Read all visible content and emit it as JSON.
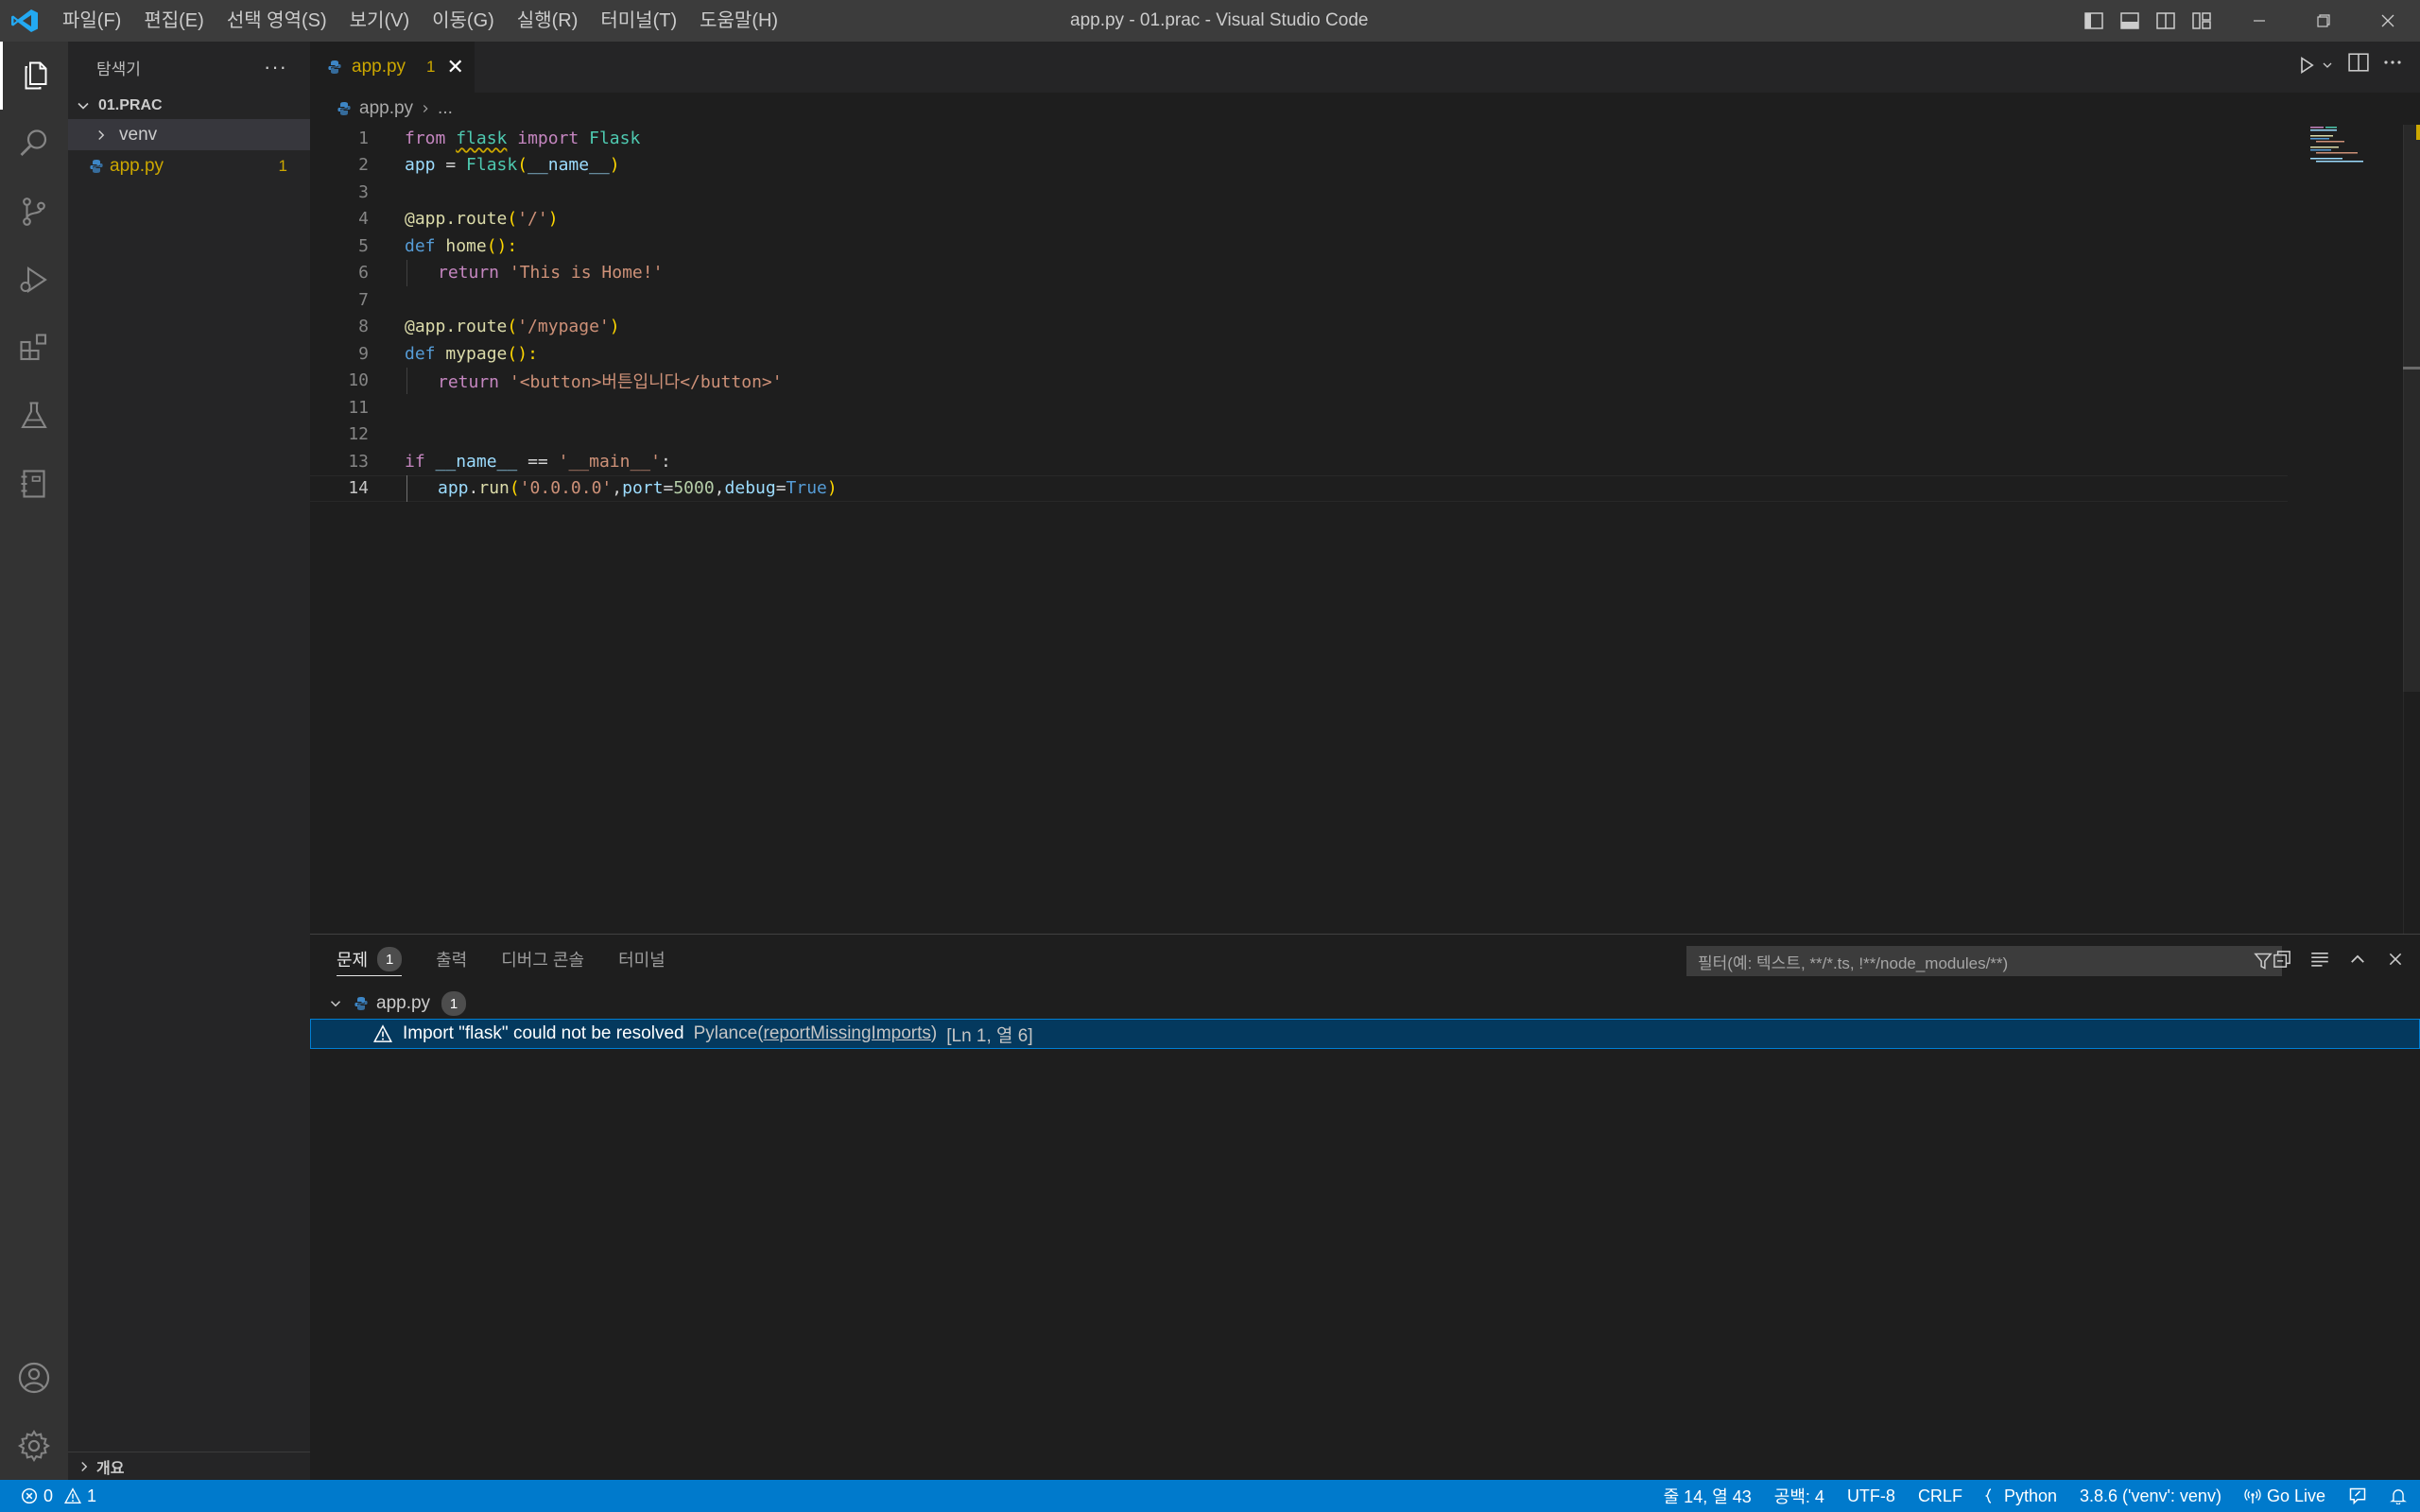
{
  "window": {
    "title": "app.py - 01.prac - Visual Studio Code",
    "menu": [
      "파일(F)",
      "편집(E)",
      "선택 영역(S)",
      "보기(V)",
      "이동(G)",
      "실행(R)",
      "터미널(T)",
      "도움말(H)"
    ]
  },
  "colors": {
    "accent": "#007acc",
    "warning": "#cca700",
    "selection": "#04395e"
  },
  "sidebar": {
    "title": "탐색기",
    "more": "···",
    "folder": "01.PRAC",
    "items": [
      {
        "label": "venv",
        "type": "folder"
      },
      {
        "label": "app.py",
        "type": "file",
        "badge": "1"
      }
    ],
    "outline": "개요"
  },
  "editor": {
    "tab": {
      "label": "app.py",
      "problems": "1",
      "close": "✕"
    },
    "breadcrumb": {
      "file": "app.py",
      "rest": "..."
    },
    "line_numbers": [
      "1",
      "2",
      "3",
      "4",
      "5",
      "6",
      "7",
      "8",
      "9",
      "10",
      "11",
      "12",
      "13",
      "14"
    ],
    "current_line": "14",
    "tokens": {
      "l1": [
        "from",
        "flask",
        "import",
        "Flask"
      ],
      "l2": [
        "app",
        "=",
        "Flask",
        "(",
        "__name__",
        ")"
      ],
      "l4": [
        "@app.route",
        "(",
        "'/'",
        ")"
      ],
      "l5": [
        "def",
        "home",
        "():"
      ],
      "l6": [
        "return",
        "'This is Home!'"
      ],
      "l8": [
        "@app.route",
        "(",
        "'/mypage'",
        ")"
      ],
      "l9": [
        "def",
        "mypage",
        "():"
      ],
      "l10": [
        "return",
        "'<button>버튼입니다</button>'"
      ],
      "l13": [
        "if",
        "__name__",
        "==",
        "'__main__'",
        ":"
      ],
      "l14": [
        "app",
        ".",
        "run",
        "(",
        "'0.0.0.0'",
        ",",
        "port",
        "=",
        "5000",
        ",",
        "debug",
        "=",
        "True",
        ")"
      ]
    }
  },
  "panel": {
    "tabs": [
      {
        "label": "문제",
        "badge": "1",
        "active": true
      },
      {
        "label": "출력"
      },
      {
        "label": "디버그 콘솔"
      },
      {
        "label": "터미널"
      }
    ],
    "filter_placeholder": "필터(예: 텍스트, **/*.ts, !**/node_modules/**)",
    "problems": {
      "file": "app.py",
      "count": "1",
      "issue": {
        "message": "Import \"flask\" could not be resolved",
        "source_prefix": "Pylance(",
        "source_code": "reportMissingImports",
        "source_suffix": ")",
        "position": "[Ln 1, 열 6]"
      }
    }
  },
  "statusbar": {
    "errors": "0",
    "warnings": "1",
    "position": "줄 14, 열 43",
    "indent": "공백: 4",
    "encoding": "UTF-8",
    "eol": "CRLF",
    "language": "Python",
    "interpreter": "3.8.6 ('venv': venv)",
    "live": "Go Live"
  }
}
